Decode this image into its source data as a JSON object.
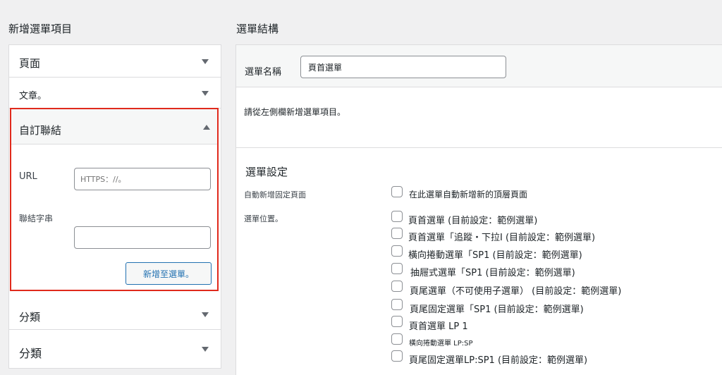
{
  "left_panel": {
    "heading": "新增選單項目",
    "sections": {
      "page": "頁面",
      "post": "文章。",
      "custom_link": "自訂聯結",
      "category_1": "分類",
      "category_2": "分類"
    },
    "custom_link": {
      "url_label": "URL",
      "url_placeholder": "HTTPS：//。",
      "text_label": "聯結字串",
      "text_value": "",
      "add_button": "新增至選單。"
    }
  },
  "right_panel": {
    "heading": "選單結構",
    "menu_name_label": "選單名稱",
    "menu_name_value": "頁首選單",
    "empty_instruction": "請從左側欄新增選單項目。",
    "settings": {
      "heading": "選單設定",
      "auto_add_label": "自動新增固定頁面",
      "auto_add_option": "在此選單自動新增新的頂層頁面",
      "location_label": "選單位置。",
      "locations": [
        "頁首選單 (目前設定：範例選單)",
        "頁首選單「追蹤・下拉I (目前設定：範例選單)",
        "橫向捲動選單「SP1 (目前設定：範例選單)",
        "抽屜式選單「SP1 (目前設定：範例選單)",
        "頁尾選單（不可使用子選單） (目前設定：範例選單)",
        "頁尾固定選單「SP1 (目前設定：範例選單)",
        "頁首選單 LP 1",
        "橫向捲動選單 LP:SP",
        "頁尾固定選單LP:SP1 (目前設定：範例選單)"
      ]
    }
  }
}
